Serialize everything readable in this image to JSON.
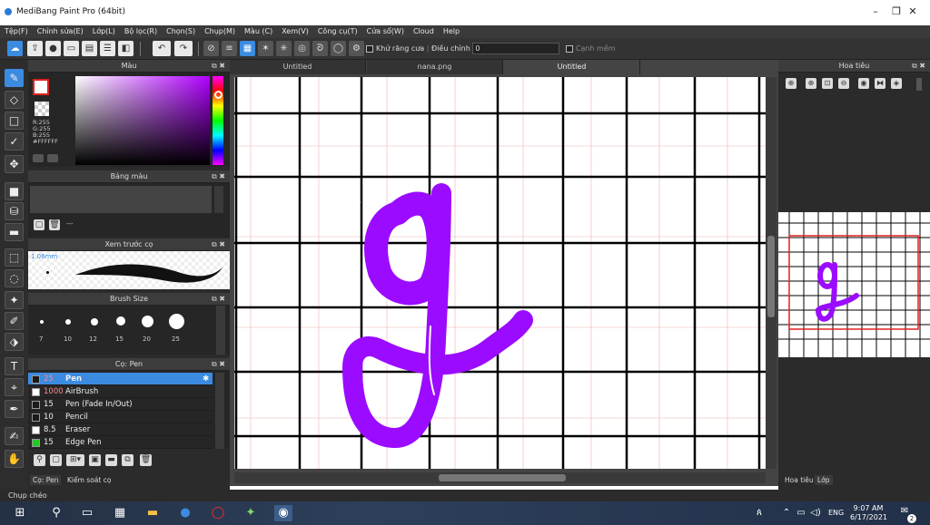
{
  "window": {
    "title": "MediBang Paint Pro (64bit)",
    "minimize": "–",
    "maximize": "❐",
    "close": "✕"
  },
  "menu": [
    "Tệp(F)",
    "Chỉnh sửa(E)",
    "Lớp(L)",
    "Bộ lọc(R)",
    "Chọn(S)",
    "Chụp(M)",
    "Màu (C)",
    "Xem(V)",
    "Công cụ(T)",
    "Cửa sổ(W)",
    "Cloud",
    "Help"
  ],
  "tool_options": {
    "antialias_label": "Khử răng cưa",
    "adjust_label": "Điều chỉnh",
    "adjust_value": "0",
    "edge_label": "Cạnh mềm"
  },
  "color_panel": {
    "title": "Màu",
    "r": "R:255",
    "g": "G:255",
    "b": "B:255",
    "hex": "#FFFFFF"
  },
  "palette_panel": {
    "title": "Bảng màu",
    "dash": "---"
  },
  "brush_preview": {
    "title": "Xem trước cọ",
    "size": "1.06mm"
  },
  "brush_size": {
    "title": "Brush Size",
    "labels": [
      "7",
      "10",
      "12",
      "15",
      "20",
      "25"
    ]
  },
  "brush_panel": {
    "title": "Cọ: Pen",
    "items": [
      {
        "size": "25",
        "name": "Pen",
        "color": "#1a1a1a",
        "selected": true
      },
      {
        "size": "1000",
        "name": "AirBrush",
        "color": "#ffffff",
        "selected": false
      },
      {
        "size": "15",
        "name": "Pen (Fade In/Out)",
        "color": "#1a1a1a",
        "selected": false
      },
      {
        "size": "10",
        "name": "Pencil",
        "color": "#1a1a1a",
        "selected": false
      },
      {
        "size": "8.5",
        "name": "Eraser",
        "color": "#ffffff",
        "selected": false
      },
      {
        "size": "15",
        "name": "Edge Pen",
        "color": "#22cc22",
        "selected": false
      }
    ]
  },
  "bottom_tabs": {
    "tab1": "Cọ: Pen",
    "tab2": "Kiểm soát cọ"
  },
  "doc_tabs": [
    "Untitled",
    "nana.png",
    "Untitled"
  ],
  "navigator": {
    "title": "Hoa tiêu",
    "tab1": "Hoa tiêu",
    "tab2": "Lớp"
  },
  "status": {
    "text": "Chụp chéo"
  },
  "taskbar": {
    "lang": "ENG",
    "time": "9:07 AM",
    "date": "6/17/2021",
    "notif": "2"
  },
  "colors": {
    "accent": "#3b8be0",
    "stroke": "#9b0bff",
    "annotation": "#e02020"
  }
}
